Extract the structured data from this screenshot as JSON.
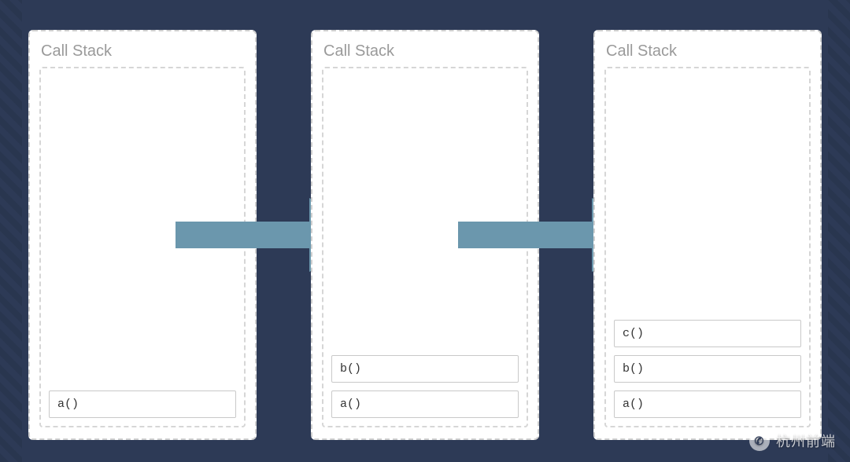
{
  "title": "Call Stack",
  "arrow_color": "#6b97ad",
  "stacks": [
    {
      "frames": [
        "a()"
      ]
    },
    {
      "frames": [
        "b()",
        "a()"
      ]
    },
    {
      "frames": [
        "c()",
        "b()",
        "a()"
      ]
    }
  ],
  "watermark": {
    "label": "杭州前端",
    "icon": "wechat-icon"
  }
}
